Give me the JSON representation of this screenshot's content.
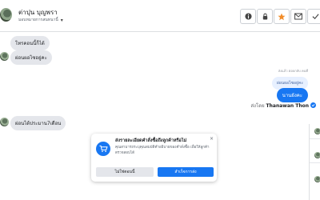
{
  "header": {
    "name": "ต่าปุน บุญพรา",
    "subtitle": "มอบหมายการสนทนานี้",
    "toolbar": [
      "info-icon",
      "star-icon",
      "mail-icon",
      "check-icon",
      "tag-icon"
    ]
  },
  "messages": {
    "in_1": "โทรคอนนี้ก็ได้",
    "in_2": "ผ่อนผอไซอยู่คะ",
    "out_meta": "ส่งแล้ว ตอบกลับ คนที่",
    "out_quote": "ผ่อนผอไซอยู่คะ",
    "out_reply": "นานยังคะ",
    "sent_by_prefix": "ส่งโดย",
    "sent_by_name": "Thanawan Thon",
    "in_3": "ผ่อนได้ประมาน7เดือน"
  },
  "popup": {
    "title": "ส่งรายละเอียดคำสั่งซื้อถึงลูกค้าหรือไม่",
    "description": "คุณสามารถระบุคุณสมบัติคำอธิบายของคำสั่งซื้อ เพื่อให้ลูกค้าตรวจสอบได้",
    "no_label": "ไม่ใช่ตอนนี้",
    "yes_label": "สำเร็จการส่ง"
  },
  "colors": {
    "accent": "#1877f2",
    "bubble_in": "#e4e6eb"
  }
}
